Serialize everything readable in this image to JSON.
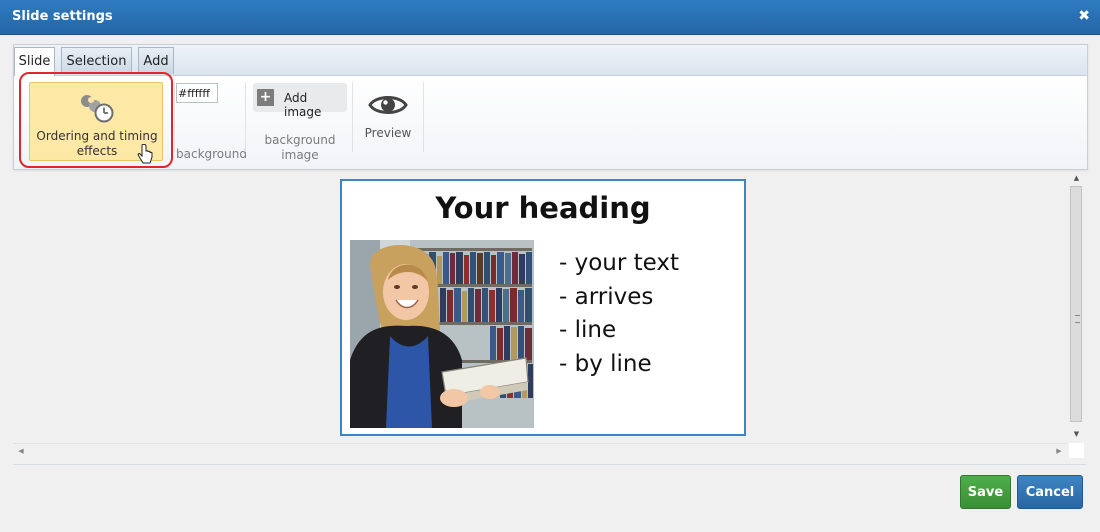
{
  "dialog": {
    "title": "Slide settings",
    "close_glyph": "✖"
  },
  "tabs": [
    {
      "label": "Slide",
      "active": true
    },
    {
      "label": "Selection",
      "active": false
    },
    {
      "label": "Add",
      "active": false
    }
  ],
  "ribbon": {
    "ordering_button": {
      "label_line1": "Ordering and timing",
      "label_line2": "effects",
      "icon": "timing-icon"
    },
    "background": {
      "value": "#ffffff",
      "label": "background"
    },
    "add_image": {
      "label": "Add image",
      "icon": "plus-icon",
      "plus_glyph": "+"
    },
    "background_image": {
      "label_line1": "background",
      "label_line2": "image"
    },
    "preview": {
      "label": "Preview",
      "icon": "eye-icon"
    }
  },
  "slide": {
    "heading": "Your heading",
    "bullets": [
      "- your text",
      "- arrives",
      "- line",
      "- by line"
    ],
    "photo": "student-holding-books-photo"
  },
  "scroll": {
    "up": "▲",
    "down": "▼",
    "left": "◀",
    "right": "▶"
  },
  "footer": {
    "save_label": "Save",
    "cancel_label": "Cancel"
  },
  "colors": {
    "title_bar": "#2a70b4",
    "highlight": "#e0262c",
    "ordering_button": "#fde8a6",
    "save": "#3f9e3b",
    "cancel": "#2f74b5",
    "slide_border": "#3d86c6"
  }
}
